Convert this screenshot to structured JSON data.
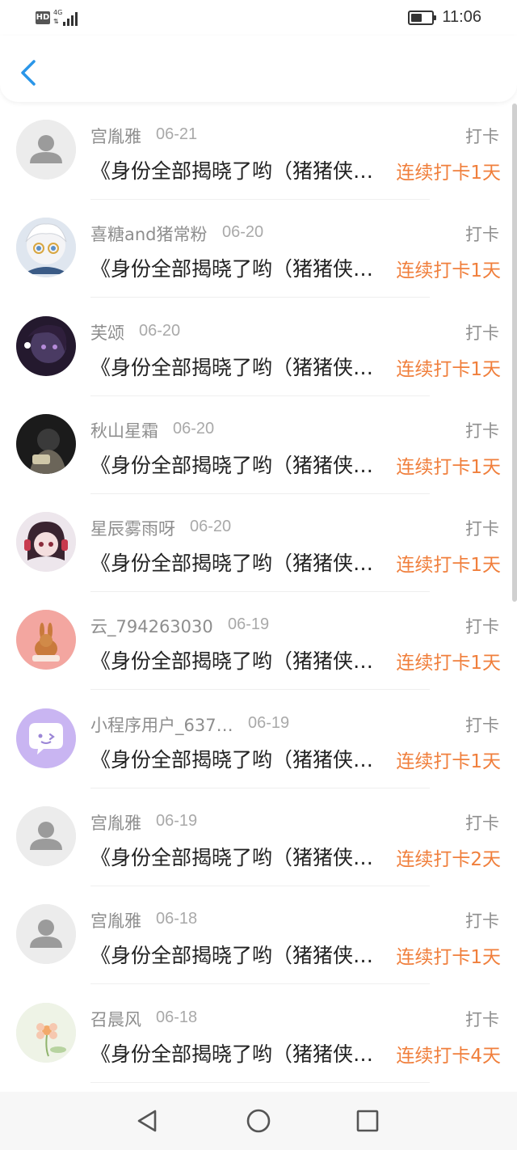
{
  "status_bar": {
    "hd_label": "HD",
    "network_label": "4G",
    "time": "11:06",
    "battery_level": 0.55
  },
  "nav": {
    "back_icon": "chevron-left-icon"
  },
  "colors": {
    "accent": "#2a96e8",
    "streak": "#f07f3c",
    "name": "#8e8e8e",
    "date": "#a9a9a9",
    "title": "#222222"
  },
  "records": [
    {
      "name": "宫胤雅",
      "date": "06-21",
      "type": "打卡",
      "title": "《身份全部揭晓了哟（猪猪侠系列）》",
      "streak": "连续打卡1天",
      "avatar": "default-avatar-icon"
    },
    {
      "name": "喜糖and猪常粉",
      "date": "06-20",
      "type": "打卡",
      "title": "《身份全部揭晓了哟（猪猪侠系列）》",
      "streak": "连续打卡1天",
      "avatar": "anime-avatar-white-hair"
    },
    {
      "name": "芙颂",
      "date": "06-20",
      "type": "打卡",
      "title": "《身份全部揭晓了哟（猪猪侠系列）》",
      "streak": "连续打卡1天",
      "avatar": "anime-avatar-dark"
    },
    {
      "name": "秋山星霜",
      "date": "06-20",
      "type": "打卡",
      "title": "《身份全部揭晓了哟（猪猪侠系列）》",
      "streak": "连续打卡1天",
      "avatar": "photo-avatar-dark"
    },
    {
      "name": "星辰雾雨呀",
      "date": "06-20",
      "type": "打卡",
      "title": "《身份全部揭晓了哟（猪猪侠系列）》",
      "streak": "连续打卡1天",
      "avatar": "anime-avatar-headphones"
    },
    {
      "name": "云_794263030",
      "date": "06-19",
      "type": "打卡",
      "title": "《身份全部揭晓了哟（猪猪侠系列）》",
      "streak": "连续打卡1天",
      "avatar": "rabbit-avatar"
    },
    {
      "name": "小程序用户_637…",
      "date": "06-19",
      "type": "打卡",
      "title": "《身份全部揭晓了哟（猪猪侠系列）》",
      "streak": "连续打卡1天",
      "avatar": "chat-bubble-avatar"
    },
    {
      "name": "宫胤雅",
      "date": "06-19",
      "type": "打卡",
      "title": "《身份全部揭晓了哟（猪猪侠系列）》",
      "streak": "连续打卡2天",
      "avatar": "default-avatar-icon"
    },
    {
      "name": "宫胤雅",
      "date": "06-18",
      "type": "打卡",
      "title": "《身份全部揭晓了哟（猪猪侠系列）》",
      "streak": "连续打卡1天",
      "avatar": "default-avatar-icon"
    },
    {
      "name": "召晨风",
      "date": "06-18",
      "type": "打卡",
      "title": "《身份全部揭晓了哟（猪猪侠系列）》",
      "streak": "连续打卡4天",
      "avatar": "flower-avatar"
    }
  ],
  "system_nav": {
    "back": "triangle-back-icon",
    "home": "circle-home-icon",
    "recents": "square-recents-icon"
  }
}
